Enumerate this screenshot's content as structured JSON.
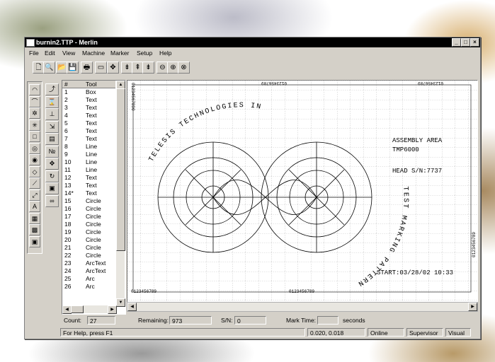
{
  "window": {
    "title": "burnin2.TTP - Merlin"
  },
  "menu": [
    "File",
    "Edit",
    "View",
    "Machine",
    "Marker",
    "Setup",
    "Help"
  ],
  "toolbar": [
    {
      "name": "new-icon",
      "glyph": "🗋"
    },
    {
      "name": "preview-icon",
      "glyph": "🔍"
    },
    {
      "name": "open-icon",
      "glyph": "📂"
    },
    {
      "name": "save-icon",
      "glyph": "💾"
    },
    {
      "name": "print-icon",
      "glyph": "🖶"
    },
    {
      "name": "marker-icon",
      "glyph": "▭"
    },
    {
      "name": "move-icon",
      "glyph": "✥"
    },
    {
      "name": "align-left-icon",
      "glyph": "⇟"
    },
    {
      "name": "align-center-icon",
      "glyph": "⇞"
    },
    {
      "name": "align-right-icon",
      "glyph": "⇟"
    },
    {
      "name": "zoom-icon",
      "glyph": "⊖"
    },
    {
      "name": "zoom-in-icon",
      "glyph": "⊕"
    },
    {
      "name": "zoom-out-icon",
      "glyph": "⊗"
    }
  ],
  "left_tools": [
    {
      "name": "arc-tool-icon",
      "glyph": "◠"
    },
    {
      "name": "arc-text-tool-icon",
      "glyph": "⌒"
    },
    {
      "name": "star-tool-icon",
      "glyph": "✲"
    },
    {
      "name": "burst-tool-icon",
      "glyph": "✳"
    },
    {
      "name": "box-tool-icon",
      "glyph": "□"
    },
    {
      "name": "circle-tool-icon",
      "glyph": "◎"
    },
    {
      "name": "ellipse-tool-icon",
      "glyph": "◉"
    },
    {
      "name": "diamond-tool-icon",
      "glyph": "◇"
    },
    {
      "name": "line-tool-icon",
      "glyph": "⟋"
    },
    {
      "name": "polyline-tool-icon",
      "glyph": "⤢"
    },
    {
      "name": "text-tool-icon",
      "glyph": "A"
    },
    {
      "name": "barcode-tool-icon",
      "glyph": "▦"
    },
    {
      "name": "datamatrix-tool-icon",
      "glyph": "▩"
    },
    {
      "name": "fill-tool-icon",
      "glyph": "▣"
    }
  ],
  "mid_tools": [
    {
      "name": "transform-icon",
      "glyph": "⤴"
    },
    {
      "name": "hourglass-icon",
      "glyph": "⌛"
    },
    {
      "name": "align-bottom-icon",
      "glyph": "⊥"
    },
    {
      "name": "resize-icon",
      "glyph": "⇲"
    },
    {
      "name": "grid-icon",
      "glyph": "▤"
    },
    {
      "name": "serial-number-icon",
      "glyph": "№"
    },
    {
      "name": "move-object-icon",
      "glyph": "✥"
    },
    {
      "name": "rotate-icon",
      "glyph": "↻"
    },
    {
      "name": "frame-icon",
      "glyph": "▣"
    },
    {
      "name": "link-icon",
      "glyph": "∞"
    }
  ],
  "object_list": {
    "headers": [
      "#",
      "Tool"
    ],
    "rows": [
      [
        "1",
        "Box"
      ],
      [
        "2",
        "Text"
      ],
      [
        "3",
        "Text"
      ],
      [
        "4",
        "Text"
      ],
      [
        "5",
        "Text"
      ],
      [
        "6",
        "Text"
      ],
      [
        "7",
        "Text"
      ],
      [
        "8",
        "Line"
      ],
      [
        "9",
        "Line"
      ],
      [
        "10",
        "Line"
      ],
      [
        "11",
        "Line"
      ],
      [
        "12",
        "Text"
      ],
      [
        "13",
        "Text"
      ],
      [
        "14*",
        "Text"
      ],
      [
        "15",
        "Circle"
      ],
      [
        "16",
        "Circle"
      ],
      [
        "17",
        "Circle"
      ],
      [
        "18",
        "Circle"
      ],
      [
        "19",
        "Circle"
      ],
      [
        "20",
        "Circle"
      ],
      [
        "21",
        "Circle"
      ],
      [
        "22",
        "Circle"
      ],
      [
        "23",
        "ArcText"
      ],
      [
        "24",
        "ArcText"
      ],
      [
        "25",
        "Arc"
      ],
      [
        "26",
        "Arc"
      ]
    ]
  },
  "canvas": {
    "ruler_digits": "0123456789",
    "top_ruler_left": "01234567890",
    "side_ruler_left": "0123456789",
    "company_arc": "TELESIS TECHNOLOGIES INC.",
    "test_arc": "TEST MARKING PATTERN",
    "assembly_line1": "ASSEMBLY AREA",
    "assembly_line2": "TMP6000",
    "head_sn": "HEAD S/N:7737",
    "start": "START:03/28/02 10:33"
  },
  "status_line": {
    "count_label": "Count:",
    "count_value": "27",
    "remaining_label": "Remaining:",
    "remaining_value": "973",
    "sn_label": "S/N:",
    "sn_value": "0",
    "mark_time_label": "Mark Time:",
    "mark_time_value": "",
    "seconds_label": "seconds"
  },
  "status_bar": {
    "help": "For Help, press F1",
    "coords": "0.020, 0.018",
    "state": "Online",
    "user": "Supervisor",
    "mode": "Visual"
  }
}
